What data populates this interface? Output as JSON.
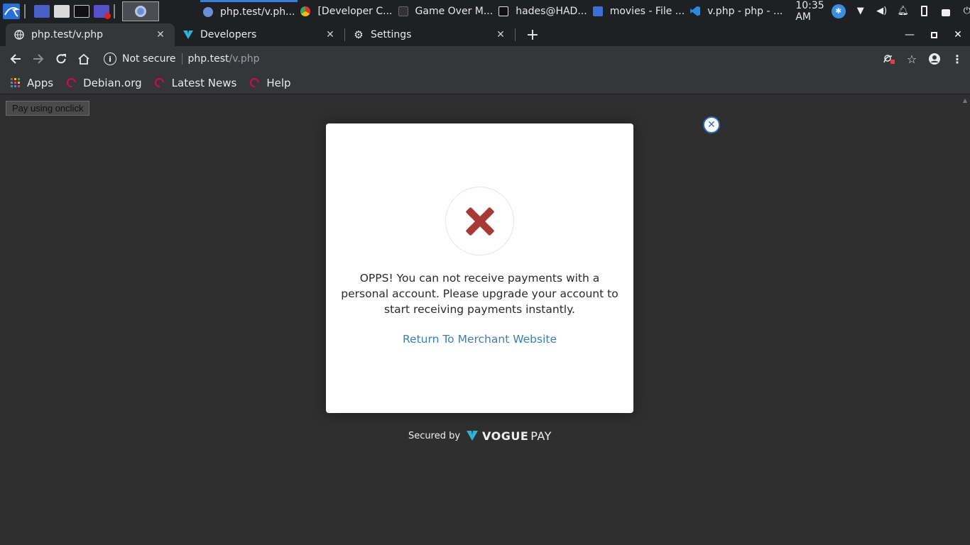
{
  "taskbar": {
    "windows": [
      {
        "title": "php.test/v.ph...",
        "icon": "chrome-icon",
        "active": true
      },
      {
        "title": "[Developer C...",
        "icon": "chrome-icon",
        "active": false
      },
      {
        "title": "Game Over M...",
        "icon": "video-icon",
        "active": false
      },
      {
        "title": "hades@HAD...",
        "icon": "terminal-icon",
        "active": false
      },
      {
        "title": "movies - File ...",
        "icon": "folder-icon",
        "active": false
      },
      {
        "title": "v.php - php - ...",
        "icon": "vscode-icon",
        "active": false
      }
    ],
    "clock": "10:35 AM"
  },
  "browser": {
    "tabs": [
      {
        "title": "php.test/v.php",
        "icon": "globe-icon",
        "active": true
      },
      {
        "title": "Developers",
        "icon": "voguepay-icon",
        "active": false
      },
      {
        "title": "Settings",
        "icon": "gear-icon",
        "active": false
      }
    ],
    "omnibox": {
      "security": "Not secure",
      "host": "php.test",
      "path": "/v.php"
    },
    "bookmarks": [
      {
        "label": "Apps",
        "icon": "apps-grid-icon"
      },
      {
        "label": "Debian.org",
        "icon": "debian-icon"
      },
      {
        "label": "Latest News",
        "icon": "debian-icon"
      },
      {
        "label": "Help",
        "icon": "debian-icon"
      }
    ]
  },
  "page": {
    "pay_button": "Pay using onclick"
  },
  "modal": {
    "message": "OPPS! You can not receive payments with a personal account. Please upgrade your account to start receiving payments instantly.",
    "link": "Return To Merchant Website",
    "close": "✕"
  },
  "footer": {
    "secured_by": "Secured by",
    "brand_main": "VOGUE",
    "brand_sub": "PAY"
  },
  "colors": {
    "error_red": "#a83a36",
    "link_blue": "#3d7eb5",
    "backdrop": "#2f2f2f"
  }
}
